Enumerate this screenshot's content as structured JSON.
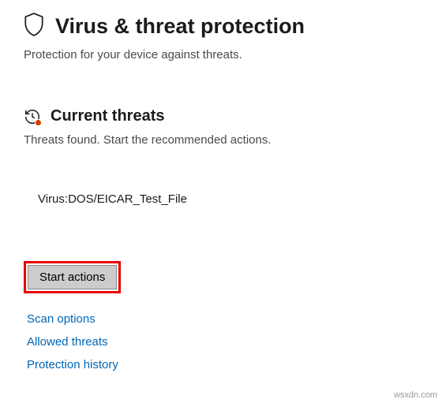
{
  "header": {
    "title": "Virus & threat protection",
    "subtitle": "Protection for your device against threats."
  },
  "current_threats": {
    "title": "Current threats",
    "subtitle": "Threats found. Start the recommended actions.",
    "threat_name": "Virus:DOS/EICAR_Test_File",
    "start_actions_label": "Start actions"
  },
  "links": {
    "scan_options": "Scan options",
    "allowed_threats": "Allowed threats",
    "protection_history": "Protection history"
  },
  "watermark": "wsxdn.com"
}
